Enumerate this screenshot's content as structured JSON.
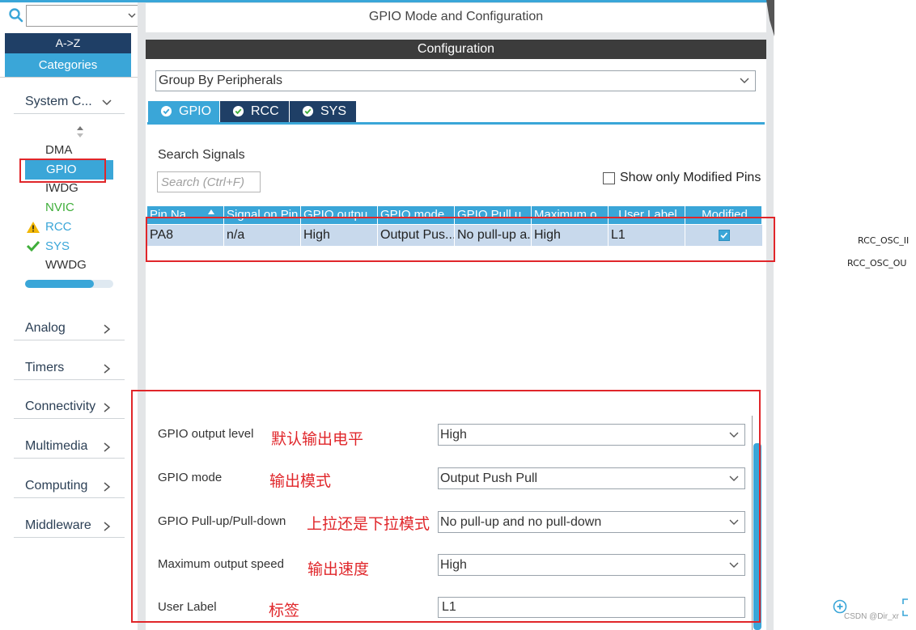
{
  "sidebar": {
    "search_value": "",
    "az_label": "A->Z",
    "categories_label": "Categories",
    "system_core": {
      "label": "System C...",
      "items": [
        "DMA",
        "GPIO",
        "IWDG",
        "NVIC",
        "RCC",
        "SYS",
        "WWDG"
      ]
    },
    "categories": [
      "Analog",
      "Timers",
      "Connectivity",
      "Multimedia",
      "Computing",
      "Middleware"
    ]
  },
  "main": {
    "title": "GPIO Mode and Configuration",
    "config_header": "Configuration",
    "group_by": "Group By Peripherals",
    "tabs": [
      "GPIO",
      "RCC",
      "SYS"
    ],
    "search_signals_label": "Search Signals",
    "search_placeholder": "Search (Ctrl+F)",
    "show_modified_label": "Show only Modified Pins",
    "table": {
      "headers": [
        "Pin Na...",
        "Signal on Pin",
        "GPIO outpu...",
        "GPIO mode",
        "GPIO Pull u...",
        "Maximum o...",
        "User Label",
        "Modified"
      ],
      "row": [
        "PA8",
        "n/a",
        "High",
        "Output Pus...",
        "No pull-up a...",
        "High",
        "L1"
      ],
      "modified": true
    },
    "props": [
      {
        "label": "GPIO output level",
        "value": "High",
        "note": "默认输出电平"
      },
      {
        "label": "GPIO mode",
        "value": "Output Push Pull",
        "note": "输出模式"
      },
      {
        "label": "GPIO Pull-up/Pull-down",
        "value": "No pull-up and no pull-down",
        "note": "上拉还是下拉模式"
      },
      {
        "label": "Maximum output speed",
        "value": "High",
        "note": "输出速度"
      },
      {
        "label": "User Label",
        "value": "L1",
        "note": "标签"
      }
    ]
  },
  "right": {
    "pins": [
      "RCC_OSC_II",
      "RCC_OSC_OU"
    ],
    "watermark": "CSDN @Dir_xr"
  },
  "colors": {
    "accent": "#3aa6d8",
    "dark_navy": "#1f3f66",
    "annotation_red": "#e0262a",
    "row_selected": "#c8d9ec"
  },
  "icons": [
    "search-icon",
    "chevron-down-icon",
    "chevron-right-icon",
    "sort-icon",
    "warning-icon",
    "check-icon",
    "zoom-icon",
    "frame-icon"
  ]
}
